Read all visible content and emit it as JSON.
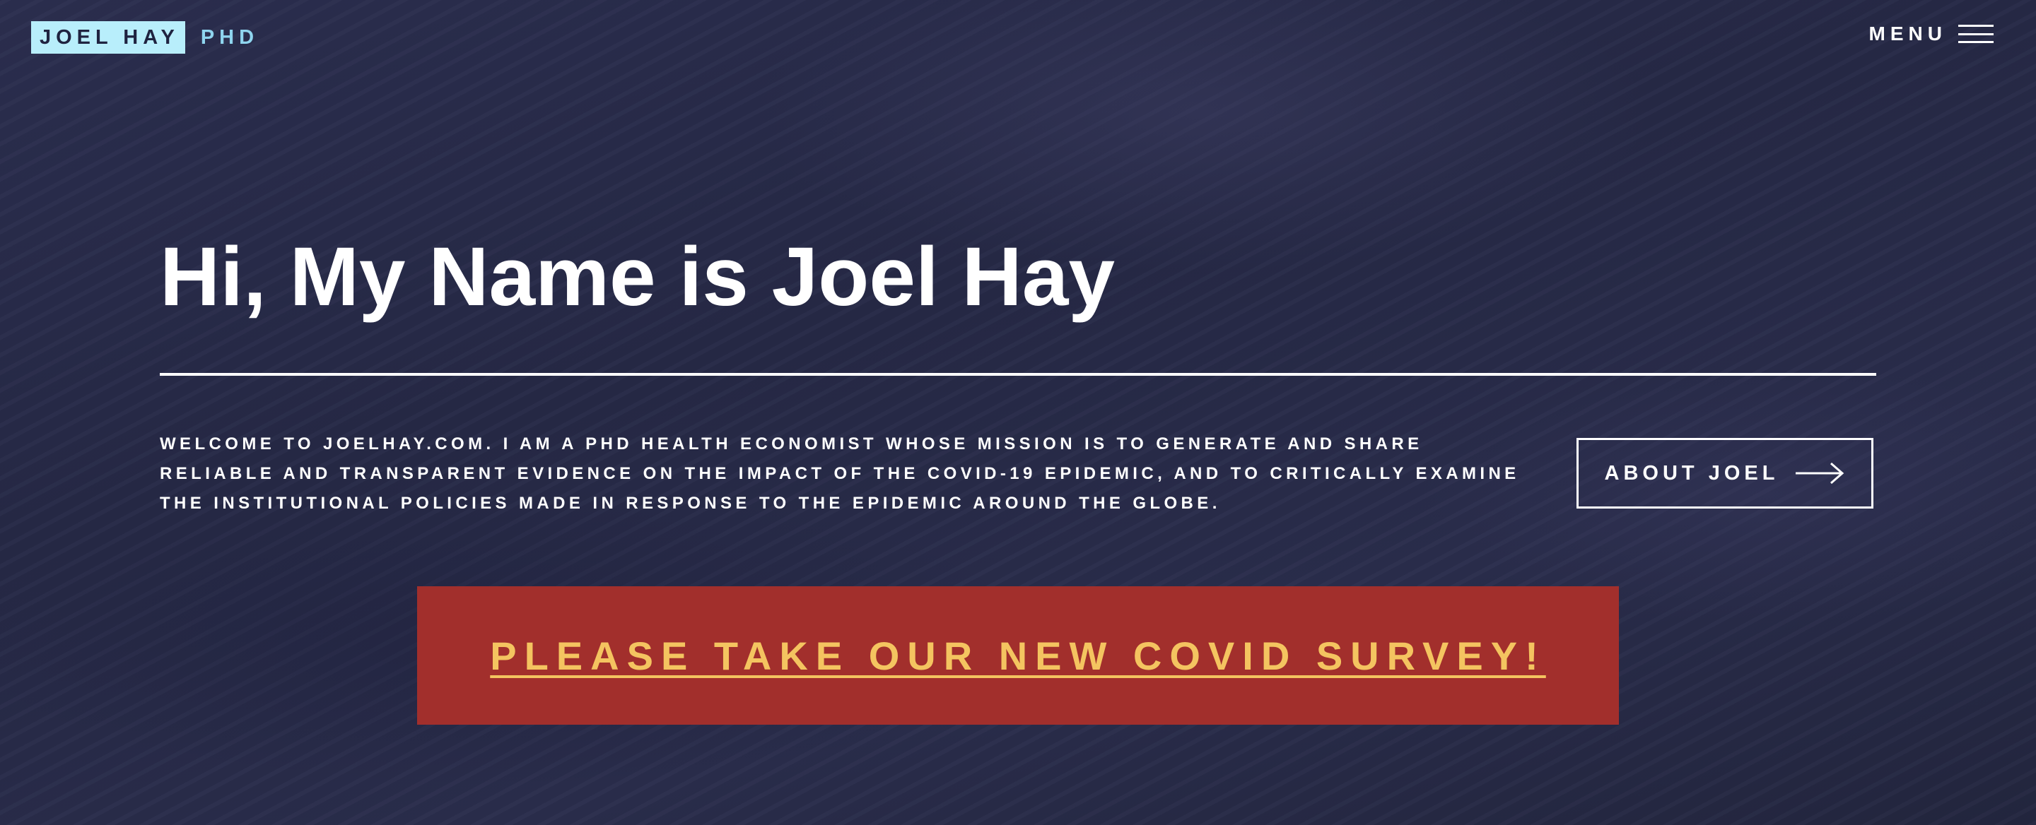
{
  "header": {
    "logo_name": "JOEL HAY",
    "logo_suffix": "PHD",
    "menu_label": "MENU",
    "menu_icon": "hamburger-icon"
  },
  "hero": {
    "title": "Hi, My Name is Joel Hay",
    "welcome_text": "WELCOME TO JOELHAY.COM. I AM A PHD HEALTH ECONOMIST WHOSE MISSION IS TO GENERATE AND SHARE RELIABLE AND TRANSPARENT EVIDENCE ON THE IMPACT OF THE COVID-19 EPIDEMIC, AND TO CRITICALLY EXAMINE THE INSTITUTIONAL POLICIES MADE IN RESPONSE TO THE EPIDEMIC AROUND THE GLOBE.",
    "about_button_label": "ABOUT JOEL",
    "about_button_icon": "arrow-right-icon"
  },
  "survey": {
    "link_text": "PLEASE TAKE OUR NEW COVID SURVEY!"
  },
  "colors": {
    "background": "#262a48",
    "logo_bg": "#b8eefb",
    "logo_suffix": "#8fd5ef",
    "banner_bg": "#a22f2c",
    "banner_text": "#f4c460",
    "text": "#ffffff"
  }
}
